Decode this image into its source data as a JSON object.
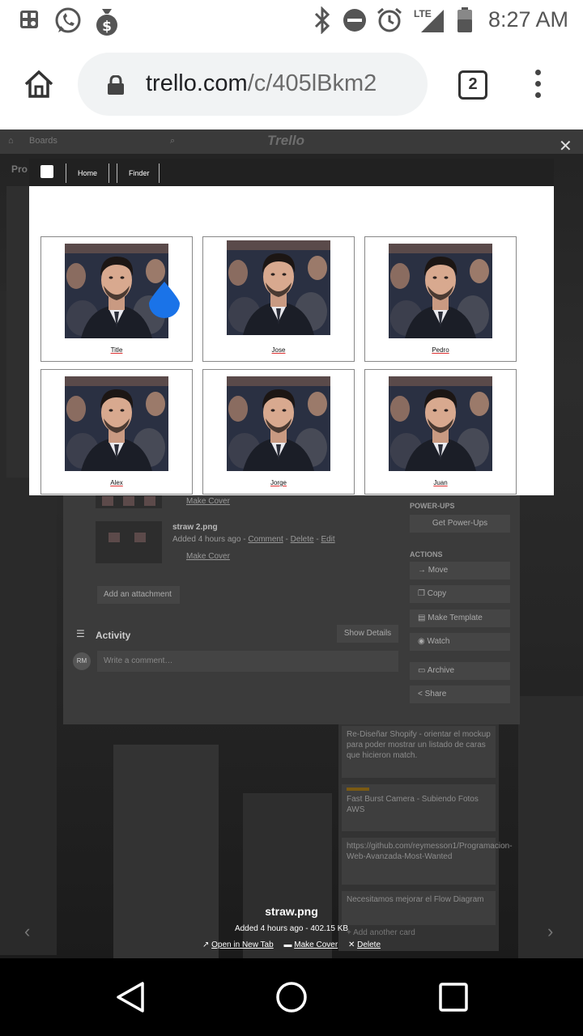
{
  "status_bar": {
    "time": "8:27 AM",
    "network": "LTE",
    "icons": [
      "gallery-icon",
      "whatsapp-icon",
      "money-bag-icon",
      "bluetooth-icon",
      "do-not-disturb-icon",
      "alarm-icon",
      "signal-icon",
      "battery-icon"
    ]
  },
  "browser": {
    "url_host": "trello.com",
    "url_path": "/c/405lBkm2",
    "tab_count": "2"
  },
  "trello_bg": {
    "boards_label": "Boards",
    "logo": "Trello",
    "board_title_fragment": "Pro",
    "attachments": [
      {
        "name": "",
        "meta": "",
        "make_cover": "Make Cover"
      },
      {
        "name": "straw 2.png",
        "meta_added": "Added 4 hours ago - ",
        "comment": "Comment",
        "delete": "Delete",
        "edit": "Edit",
        "make_cover": "Make Cover"
      }
    ],
    "add_attachment": "Add an attachment",
    "activity": "Activity",
    "show_details": "Show Details",
    "avatar_initials": "RM",
    "comment_placeholder": "Write a comment…",
    "power_ups_heading": "POWER-UPS",
    "get_power_ups": "Get Power-Ups",
    "actions_heading": "ACTIONS",
    "actions": [
      "Move",
      "Copy",
      "Make Template",
      "Watch",
      "Archive",
      "Share"
    ],
    "list_cards": [
      "Re-Diseñar Shopify - orientar el mockup para poder mostrar un listado de caras que hicieron match.",
      "Fast Burst Camera - Subiendo Fotos AWS",
      "https://github.com/reymesson1/Programacion-Web-Avanzada-Most-Wanted",
      "Necesitamos mejorar el Flow Diagram"
    ],
    "add_another_card": "+ Add another card"
  },
  "viewer": {
    "file_name": "straw.png",
    "meta": "Added 4 hours ago - 402.15 KB",
    "open_new_tab": "Open in New Tab",
    "make_cover": "Make Cover",
    "delete": "Delete"
  },
  "app": {
    "nav": {
      "home": "Home",
      "finder": "Finder"
    },
    "cards": [
      {
        "name": "Title"
      },
      {
        "name": "Jose"
      },
      {
        "name": "Pedro"
      },
      {
        "name": "Alex"
      },
      {
        "name": "Jorge"
      },
      {
        "name": "Juan"
      }
    ],
    "accent": "#1a73e8"
  }
}
